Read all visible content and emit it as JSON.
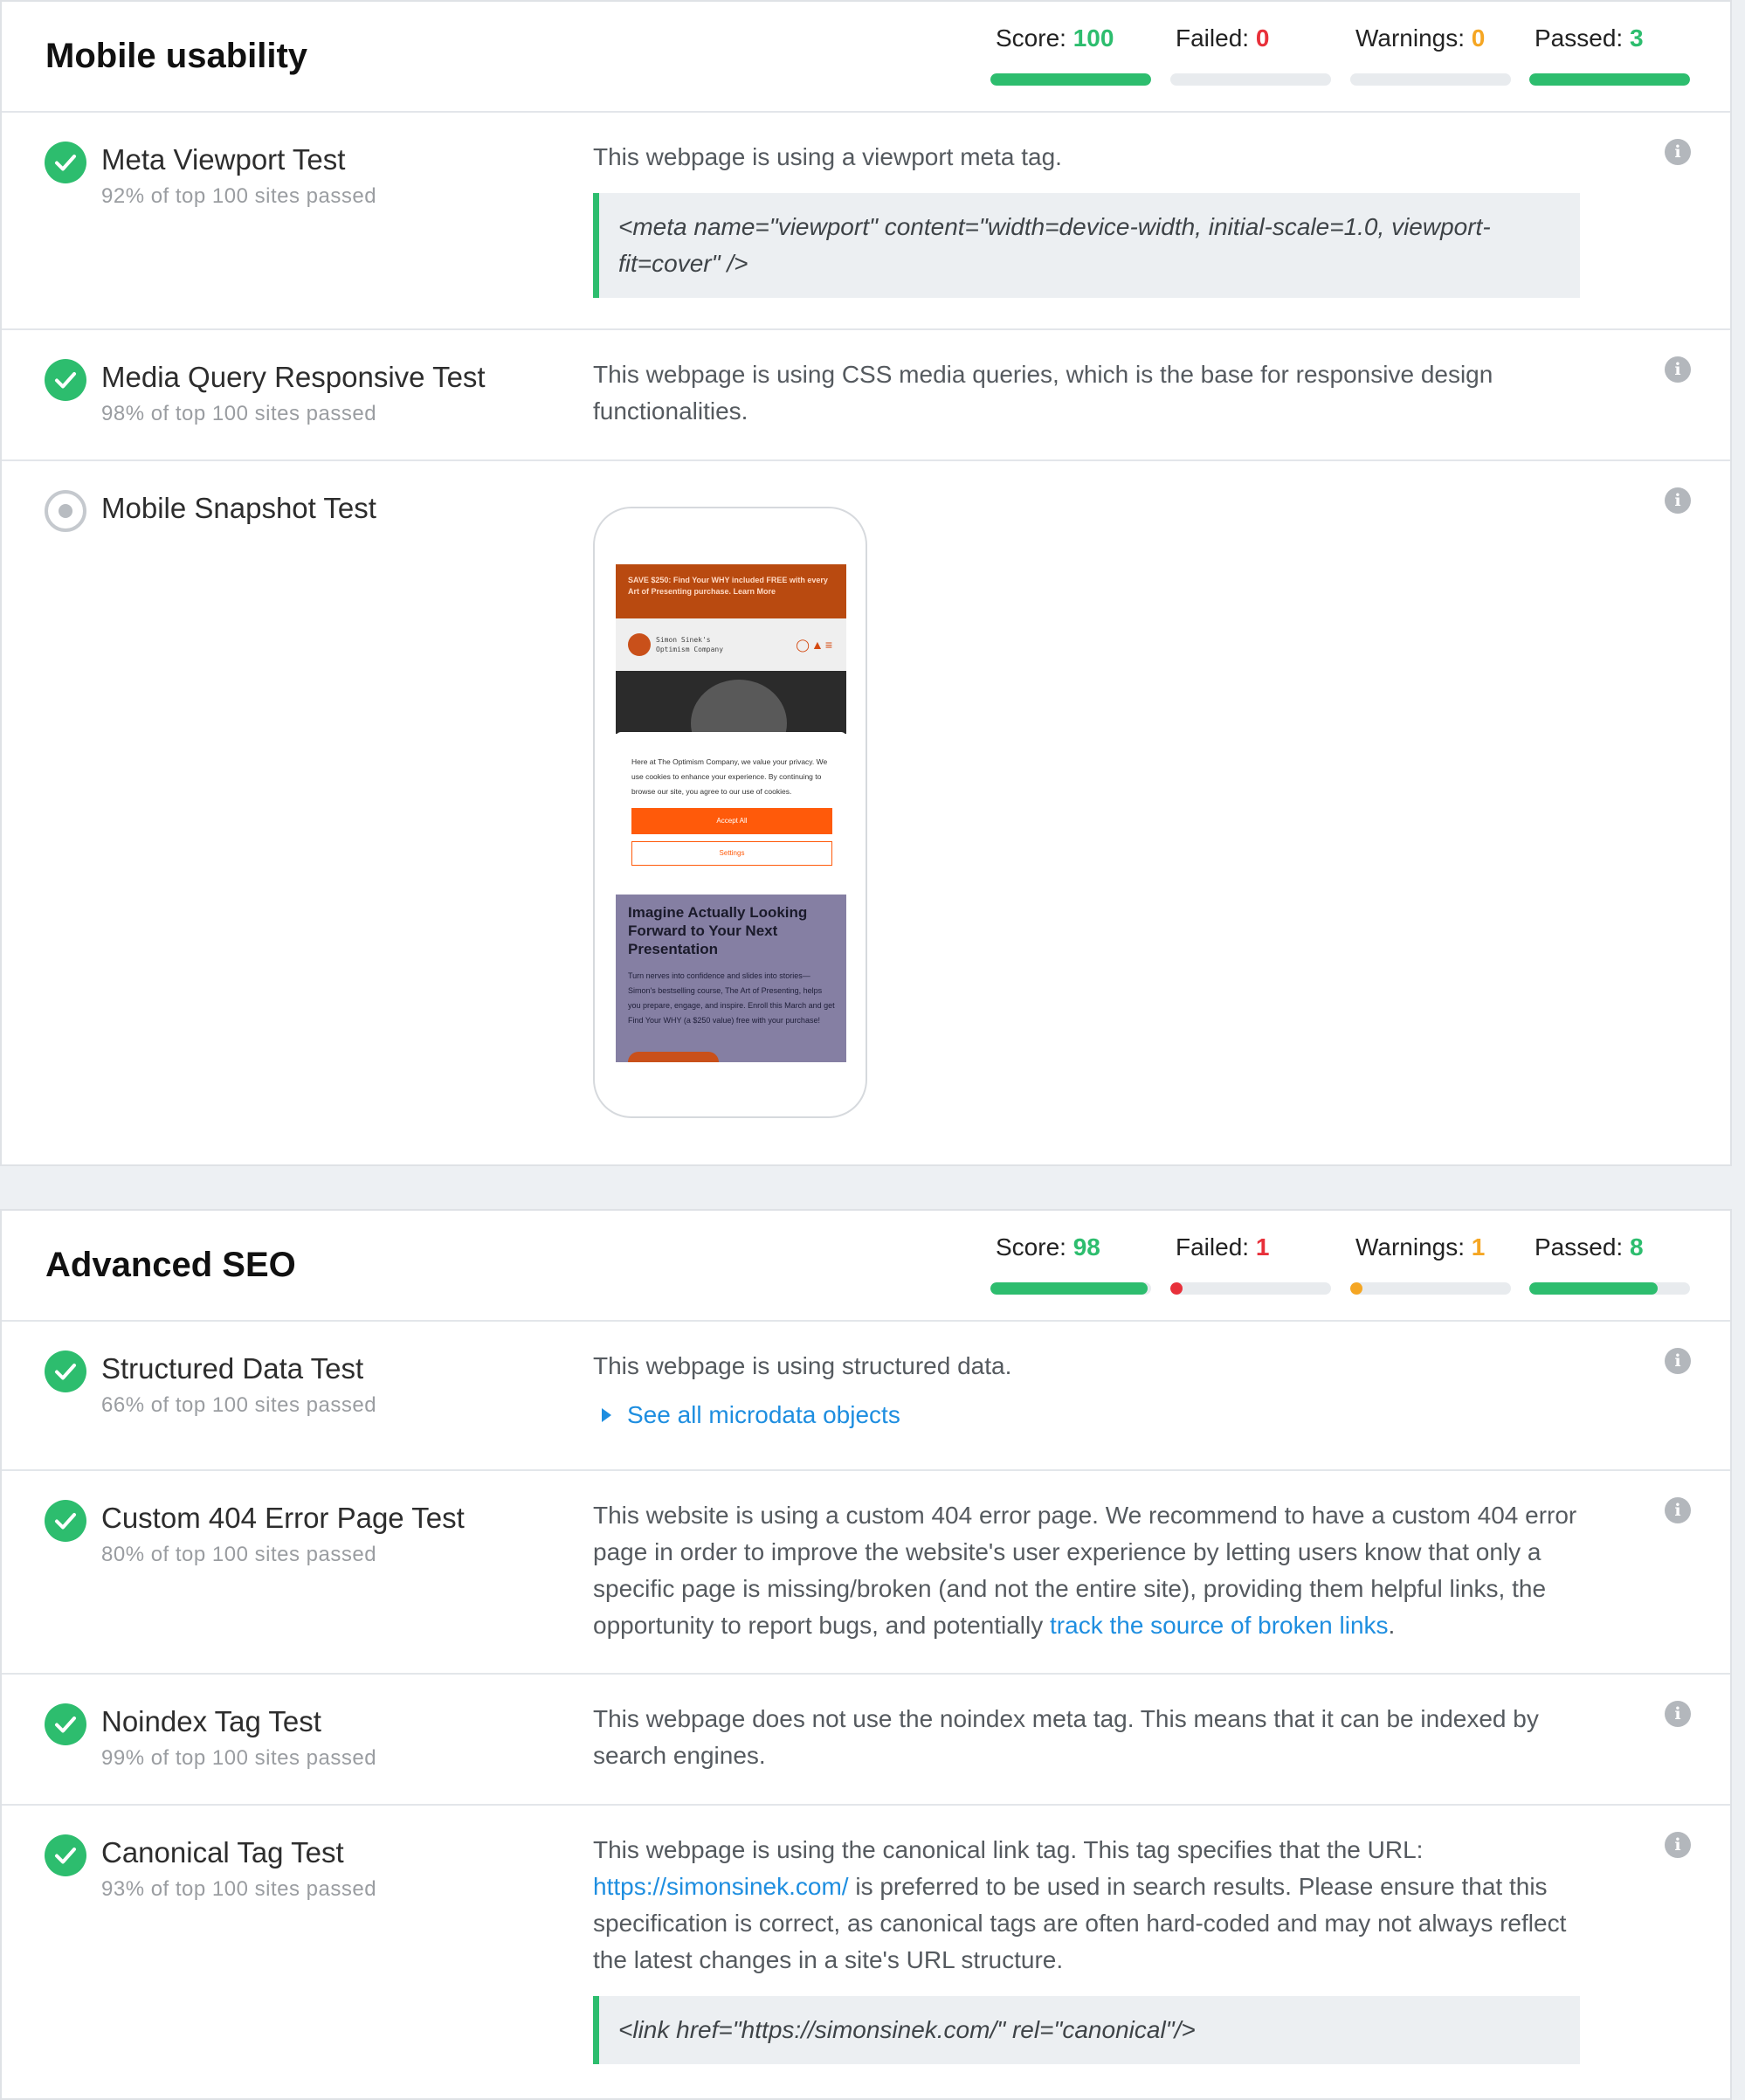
{
  "sections": [
    {
      "title": "Mobile usability",
      "score_label": "Score:",
      "score": "100",
      "failed_label": "Failed:",
      "failed": "0",
      "warnings_label": "Warnings:",
      "warnings": "0",
      "passed_label": "Passed:",
      "passed": "3",
      "bar_fills": {
        "score": 1.0,
        "failed": 0.0,
        "warnings": 0.0,
        "passed": 1.0
      },
      "tests": [
        {
          "name": "Meta Viewport Test",
          "sub": "92% of top 100 sites passed",
          "desc": "This webpage is using a viewport meta tag.",
          "code": "<meta name=\"viewport\" content=\"width=device-width, initial-scale=1.0, viewport-fit=cover\" />"
        },
        {
          "name": "Media Query Responsive Test",
          "sub": "98% of top 100 sites passed",
          "desc": "This webpage is using CSS media queries, which is the base for responsive design functionalities."
        },
        {
          "name": "Mobile Snapshot Test",
          "snapshot": {
            "promo": "SAVE $250: Find Your WHY included FREE with every Art of Presenting purchase. Learn More",
            "brand_line1": "Simon Sinek's",
            "brand_line2": "Optimism Company",
            "cookie_text": "Here at The Optimism Company, we value your privacy. We use cookies to enhance your experience. By continuing to browse our site, you agree to our use of cookies.",
            "accept": "Accept All",
            "settings": "Settings",
            "heading": "Imagine Actually Looking Forward to Your Next Presentation",
            "para": "Turn nerves into confidence and slides into stories—Simon's bestselling course, The Art of Presenting, helps you prepare, engage, and inspire. Enroll this March and get Find Your WHY (a $250 value) free with your purchase!"
          }
        }
      ]
    },
    {
      "title": "Advanced SEO",
      "score_label": "Score:",
      "score": "98",
      "failed_label": "Failed:",
      "failed": "1",
      "warnings_label": "Warnings:",
      "warnings": "1",
      "passed_label": "Passed:",
      "passed": "8",
      "bar_fills": {
        "score": 0.98,
        "failed": 0.1,
        "warnings": 0.1,
        "passed": 0.8
      },
      "tests": [
        {
          "name": "Structured Data Test",
          "sub": "66% of top 100 sites passed",
          "desc": "This webpage is using structured data.",
          "link": "See all microdata objects"
        },
        {
          "name": "Custom 404 Error Page Test",
          "sub": "80% of top 100 sites passed",
          "desc": "This website is using a custom 404 error page. We recommend to have a custom 404 error page in order to improve the website's user experience by letting users know that only a specific page is missing/broken (and not the entire site), providing them helpful links, the opportunity to report bugs, and potentially",
          "link": "track the source of broken links",
          "tail": "."
        },
        {
          "name": "Noindex Tag Test",
          "sub": "99% of top 100 sites passed",
          "desc": "This webpage does not use the noindex meta tag. This means that it can be indexed by search engines."
        },
        {
          "name": "Canonical Tag Test",
          "sub": "93% of top 100 sites passed",
          "desc": "This webpage is using the canonical link tag. This tag specifies that the URL:",
          "link": "https://simonsinek.com/",
          "tail": " is preferred to be used in search results. Please ensure that this specification is correct, as canonical tags are often hard-coded and may not always reflect the latest changes in a site's URL structure.",
          "code": "<link href=\"https://simonsinek.com/\" rel=\"canonical\"/>"
        }
      ]
    }
  ],
  "info_icon": "info-icon",
  "colors": {
    "green": "#2dbd6e",
    "red": "#e8303a",
    "orange": "#f5a623",
    "link": "#1e8ee0"
  }
}
